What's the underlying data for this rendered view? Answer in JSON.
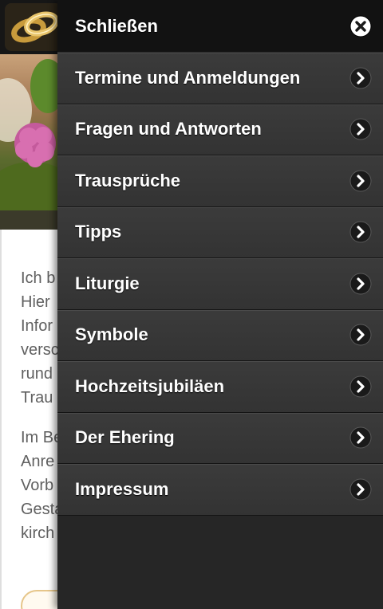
{
  "menu": {
    "close_label": "Schließen",
    "close_icon": "close-icon",
    "items": [
      {
        "label": "Termine und Anmeldungen",
        "icon": "chevron-right-icon"
      },
      {
        "label": "Fragen und Antworten",
        "icon": "chevron-right-icon"
      },
      {
        "label": "Trausprüche",
        "icon": "chevron-right-icon"
      },
      {
        "label": "Tipps",
        "icon": "chevron-right-icon"
      },
      {
        "label": "Liturgie",
        "icon": "chevron-right-icon"
      },
      {
        "label": "Symbole",
        "icon": "chevron-right-icon"
      },
      {
        "label": "Hochzeitsjubiläen",
        "icon": "chevron-right-icon"
      },
      {
        "label": "Der Ehering",
        "icon": "chevron-right-icon"
      },
      {
        "label": "Impressum",
        "icon": "chevron-right-icon"
      }
    ]
  },
  "page": {
    "text_lines_1": [
      "Ich b",
      "Hier",
      "Infor",
      "versc",
      "rund",
      "Trau"
    ],
    "text_lines_2": [
      "Im Be",
      "Anre",
      "Vorb",
      "Gesta",
      "kirch"
    ]
  },
  "colors": {
    "menu_background": "#262626",
    "menu_item": "#363636",
    "close_bar": "#121212",
    "page_text": "#606060",
    "logo_gold": "#d4a84a"
  }
}
